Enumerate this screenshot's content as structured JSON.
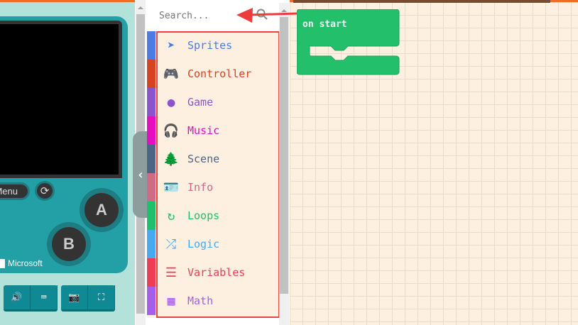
{
  "simulator": {
    "menu_label": "Menu",
    "button_a": "A",
    "button_b": "B",
    "brand": "Microsoft"
  },
  "toolbox": {
    "search_placeholder": "Search...",
    "categories": [
      {
        "label": "Sprites",
        "color": "#4b7be5",
        "icon": "paper-plane-icon"
      },
      {
        "label": "Controller",
        "color": "#d54322",
        "icon": "gamepad-icon"
      },
      {
        "label": "Game",
        "color": "#8854d0",
        "icon": "circle-icon"
      },
      {
        "label": "Music",
        "color": "#e30fc0",
        "icon": "headphones-icon"
      },
      {
        "label": "Scene",
        "color": "#4b6584",
        "icon": "tree-icon"
      },
      {
        "label": "Info",
        "color": "#cf6a87",
        "icon": "id-card-icon"
      },
      {
        "label": "Loops",
        "color": "#20bf6b",
        "icon": "loop-icon"
      },
      {
        "label": "Logic",
        "color": "#45aaf2",
        "icon": "shuffle-icon"
      },
      {
        "label": "Variables",
        "color": "#ee3c53",
        "icon": "list-icon"
      },
      {
        "label": "Math",
        "color": "#a55eea",
        "icon": "calculator-icon"
      }
    ]
  },
  "workspace": {
    "block_label": "on start",
    "block_color": "#23bf6b"
  }
}
